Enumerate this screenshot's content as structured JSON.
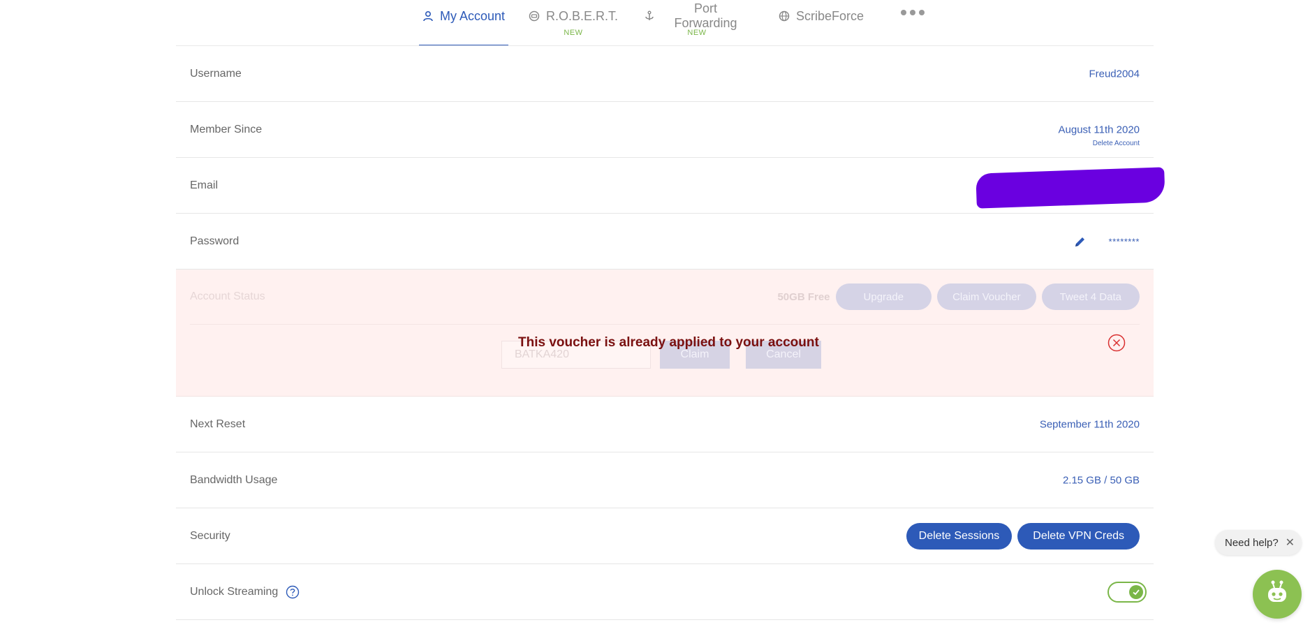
{
  "nav": {
    "tabs": [
      {
        "label": "My Account",
        "badge": ""
      },
      {
        "label": "R.O.B.E.R.T.",
        "badge": "NEW"
      },
      {
        "label": "Port Forwarding",
        "badge": "NEW"
      },
      {
        "label": "ScribeForce",
        "badge": ""
      }
    ],
    "more_icon": "ellipsis-icon"
  },
  "account": {
    "username": {
      "label": "Username",
      "value": "Freud2004"
    },
    "member_since": {
      "label": "Member Since",
      "value": "August 11th 2020",
      "delete_link": "Delete Account"
    },
    "email": {
      "label": "Email"
    },
    "password": {
      "label": "Password",
      "value": "********",
      "edit_icon": "pencil-icon"
    },
    "status": {
      "label": "Account Status",
      "plan": "50GB Free",
      "upgrade": "Upgrade",
      "claim_voucher": "Claim Voucher",
      "tweet": "Tweet 4 Data",
      "voucher_value": "BATKA420",
      "claim": "Claim",
      "cancel": "Cancel",
      "message": "This voucher is already applied to your account"
    },
    "next_reset": {
      "label": "Next Reset",
      "value": "September 11th 2020"
    },
    "bandwidth": {
      "label": "Bandwidth Usage",
      "value": "2.15 GB / 50 GB"
    },
    "security": {
      "label": "Security",
      "delete_sessions": "Delete Sessions",
      "delete_vpn_creds": "Delete VPN Creds"
    },
    "streaming": {
      "label": "Unlock Streaming",
      "enabled": true
    }
  },
  "help": {
    "text": "Need help?",
    "close": "✕"
  },
  "colors": {
    "accent": "#2d5ab8",
    "green": "#7ab648",
    "error": "#7a1010",
    "redaction": "#6a00e0"
  }
}
